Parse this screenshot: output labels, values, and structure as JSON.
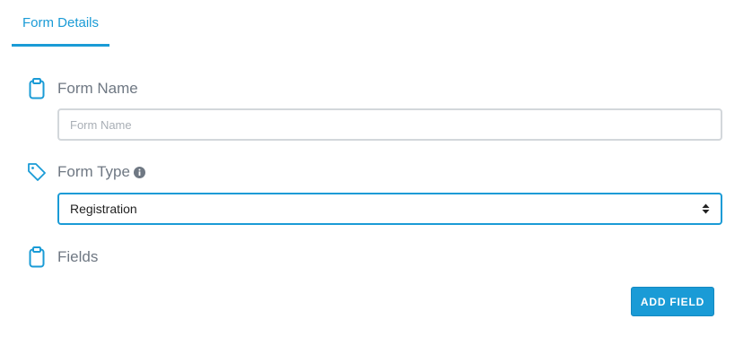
{
  "tabs": [
    {
      "label": "Form Details",
      "active": true
    }
  ],
  "form_name": {
    "label": "Form Name",
    "icon": "clipboard-icon",
    "value": "",
    "placeholder": "Form Name"
  },
  "form_type": {
    "label": "Form Type",
    "icon": "tag-icon",
    "info_icon": "info-circle-icon",
    "selected": "Registration"
  },
  "fields": {
    "label": "Fields",
    "icon": "clipboard-icon",
    "add_button_label": "ADD FIELD"
  },
  "colors": {
    "accent": "#1a9bd6",
    "label": "#6f7883",
    "border": "#d3d7db"
  }
}
